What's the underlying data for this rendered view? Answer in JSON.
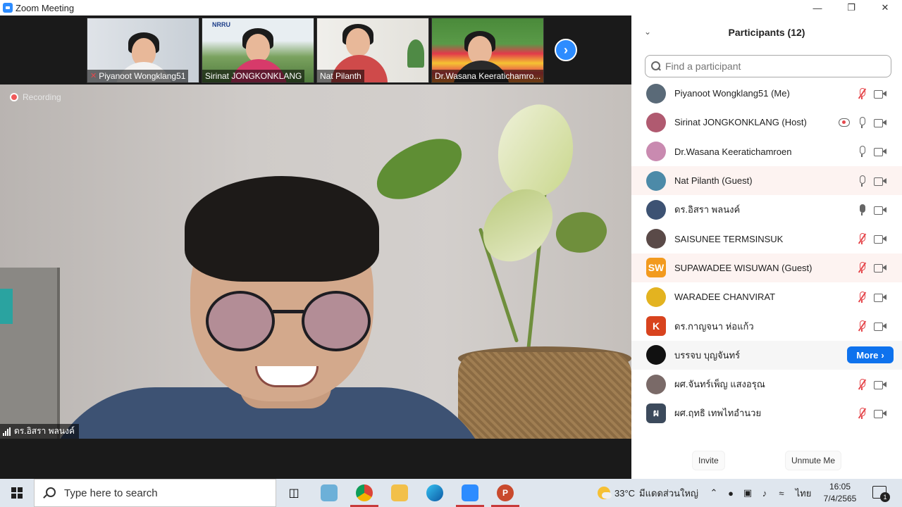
{
  "window": {
    "title": "Zoom Meeting"
  },
  "video": {
    "thumbnails": [
      {
        "name": "Piyanoot Wongklang51",
        "muted": true
      },
      {
        "name": "Sirinat JONGKONKLANG",
        "muted": false
      },
      {
        "name": "Nat Pilanth",
        "muted": false
      },
      {
        "name": "Dr.Wasana Keeratichamro...",
        "muted": false
      }
    ],
    "recording_label": "Recording",
    "active_speaker": "ดร.อิสรา พลนงค์",
    "thumb_badge": "NRRU"
  },
  "panel": {
    "title": "Participants (12)",
    "search_placeholder": "Find a participant",
    "participants": [
      {
        "name": "Piyanoot Wongklang51 (Me)",
        "mic": "muted",
        "avatar": "photo",
        "color": "#5a6a78"
      },
      {
        "name": "Sirinat JONGKONKLANG (Host)",
        "mic": "on",
        "recording": true,
        "avatar": "photo",
        "color": "#b05a70"
      },
      {
        "name": "Dr.Wasana Keeratichamroen",
        "mic": "on",
        "avatar": "photo",
        "color": "#c98ab0"
      },
      {
        "name": "Nat Pilanth (Guest)",
        "mic": "on",
        "avatar": "photo",
        "color": "#4c8aa8"
      },
      {
        "name": "ดร.อิสรา พลนงค์",
        "mic": "active",
        "avatar": "photo",
        "color": "#3d5273"
      },
      {
        "name": "SAISUNEE TERMSINSUK",
        "mic": "muted",
        "avatar": "photo",
        "color": "#5a4a48"
      },
      {
        "name": "SUPAWADEE WISUWAN (Guest)",
        "mic": "muted",
        "avatar": "initials",
        "initials": "SW",
        "color": "#f29a1e"
      },
      {
        "name": "WARADEE CHANVIRAT",
        "mic": "muted",
        "avatar": "photo",
        "color": "#e3b320"
      },
      {
        "name": "ดร.กาญจนา ห่อแก้ว",
        "mic": "muted",
        "avatar": "initials",
        "initials": "K",
        "color": "#d8431e"
      },
      {
        "name": "บรรจบ บุญจันทร์",
        "mic": "more",
        "avatar": "photo",
        "color": "#111111"
      },
      {
        "name": "ผศ.จันทร์เพ็ญ แสงอรุณ",
        "mic": "muted",
        "avatar": "photo",
        "color": "#7a6a68"
      },
      {
        "name": "ผศ.ฤทธิ เทพไทอำนวย",
        "mic": "muted",
        "avatar": "initials",
        "initials": "ผ",
        "color": "#3c4a5c"
      }
    ],
    "more_label": "More",
    "invite_label": "Invite",
    "unmute_label": "Unmute Me"
  },
  "taskbar": {
    "search_placeholder": "Type here to search",
    "weather_temp": "33°C",
    "weather_desc": "มีแดดส่วนใหญ่",
    "lang": "ไทย",
    "time": "16:05",
    "date": "7/4/2565",
    "notif_count": "1"
  }
}
